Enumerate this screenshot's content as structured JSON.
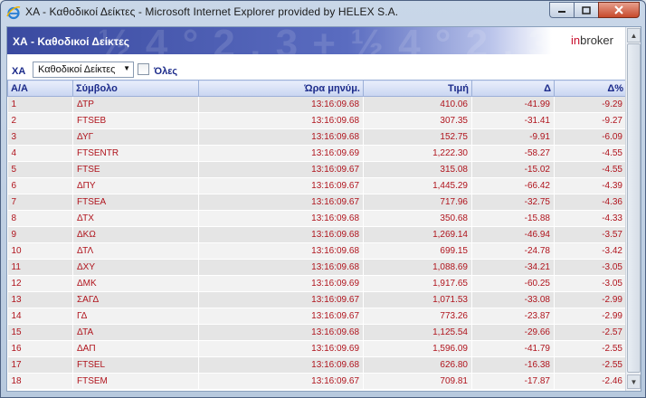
{
  "window": {
    "title": "ΧΑ - Καθοδικοί Δείκτες - Microsoft Internet Explorer provided by HELEX S.A."
  },
  "banner": {
    "title": "ΧΑ - Καθοδικοί Δείκτες",
    "logo_prefix": "in",
    "logo_suffix": "broker"
  },
  "filter": {
    "label": "ΧΑ",
    "select_value": "Καθοδικοί Δείκτες",
    "checkbox_label": "Όλες"
  },
  "table": {
    "headers": [
      "Α/Α",
      "Σύμβολο",
      "Ώρα μηνύμ.",
      "Τιμή",
      "Δ",
      "Δ%"
    ],
    "rows": [
      [
        "1",
        "ΔΤΡ",
        "13:16:09.68",
        "410.06",
        "-41.99",
        "-9.29"
      ],
      [
        "2",
        "FTSEB",
        "13:16:09.68",
        "307.35",
        "-31.41",
        "-9.27"
      ],
      [
        "3",
        "ΔΥΓ",
        "13:16:09.68",
        "152.75",
        "-9.91",
        "-6.09"
      ],
      [
        "4",
        "FTSENTR",
        "13:16:09.69",
        "1,222.30",
        "-58.27",
        "-4.55"
      ],
      [
        "5",
        "FTSE",
        "13:16:09.67",
        "315.08",
        "-15.02",
        "-4.55"
      ],
      [
        "6",
        "ΔΠΥ",
        "13:16:09.67",
        "1,445.29",
        "-66.42",
        "-4.39"
      ],
      [
        "7",
        "FTSEA",
        "13:16:09.67",
        "717.96",
        "-32.75",
        "-4.36"
      ],
      [
        "8",
        "ΔΤΧ",
        "13:16:09.68",
        "350.68",
        "-15.88",
        "-4.33"
      ],
      [
        "9",
        "ΔΚΩ",
        "13:16:09.68",
        "1,269.14",
        "-46.94",
        "-3.57"
      ],
      [
        "10",
        "ΔΤΛ",
        "13:16:09.68",
        "699.15",
        "-24.78",
        "-3.42"
      ],
      [
        "11",
        "ΔΧΥ",
        "13:16:09.68",
        "1,088.69",
        "-34.21",
        "-3.05"
      ],
      [
        "12",
        "ΔΜΚ",
        "13:16:09.69",
        "1,917.65",
        "-60.25",
        "-3.05"
      ],
      [
        "13",
        "ΣΑΓΔ",
        "13:16:09.67",
        "1,071.53",
        "-33.08",
        "-2.99"
      ],
      [
        "14",
        "ΓΔ",
        "13:16:09.67",
        "773.26",
        "-23.87",
        "-2.99"
      ],
      [
        "15",
        "ΔΤΑ",
        "13:16:09.68",
        "1,125.54",
        "-29.66",
        "-2.57"
      ],
      [
        "16",
        "ΔΑΠ",
        "13:16:09.69",
        "1,596.09",
        "-41.79",
        "-2.55"
      ],
      [
        "17",
        "FTSEL",
        "13:16:09.68",
        "626.80",
        "-16.38",
        "-2.55"
      ],
      [
        "18",
        "FTSEM",
        "13:16:09.67",
        "709.81",
        "-17.87",
        "-2.46"
      ]
    ]
  },
  "colors": {
    "value_text": "#b0141d",
    "header_text": "#1b2a8a",
    "banner_start": "#3a4aa0"
  }
}
